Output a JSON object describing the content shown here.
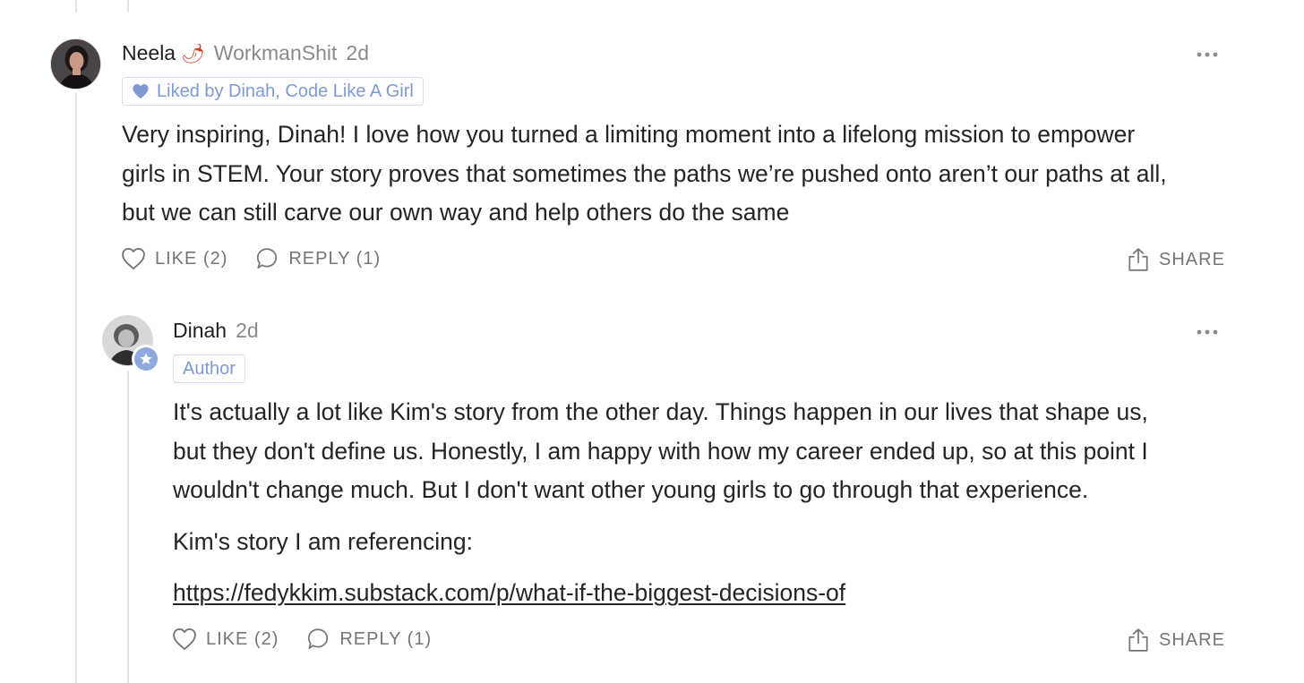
{
  "comment": {
    "author": "Neela",
    "author_emoji": "🌶",
    "handle": "WorkmanShit",
    "time": "2d",
    "liked_by": "Liked by Dinah, Code Like A Girl",
    "body": [
      "Very inspiring, Dinah! I love how you turned a limiting moment into a lifelong mission to empower",
      "girls in STEM. Your story proves that sometimes the paths we’re pushed onto aren’t our paths at all,",
      "but we can still carve our own way and help others do the same"
    ],
    "like_label": "LIKE (2)",
    "reply_label": "REPLY (1)",
    "share_label": "SHARE"
  },
  "reply": {
    "author": "Dinah",
    "time": "2d",
    "badge": "Author",
    "body": [
      "It's actually a lot like Kim's story from the other day. Things happen in our lives that shape us,",
      "but they don't define us. Honestly, I am happy with how my career ended up, so at this point I",
      "wouldn't change much. But I don't want other young girls to go through that experience."
    ],
    "reference_label": "Kim's story I am referencing:",
    "link": "https://fedykkim.substack.com/p/what-if-the-biggest-decisions-of",
    "like_label": "LIKE (2)",
    "reply_label": "REPLY (1)",
    "share_label": "SHARE"
  },
  "icons": {
    "heart": "heart-icon",
    "reply": "speech-bubble-icon",
    "share": "share-icon",
    "more": "ellipsis-icon",
    "liked": "heart-filled-icon",
    "author_badge": "star-icon"
  },
  "colors": {
    "accent": "#7f9ad2",
    "muted": "#757575",
    "thread_line": "#e3e3e3"
  }
}
